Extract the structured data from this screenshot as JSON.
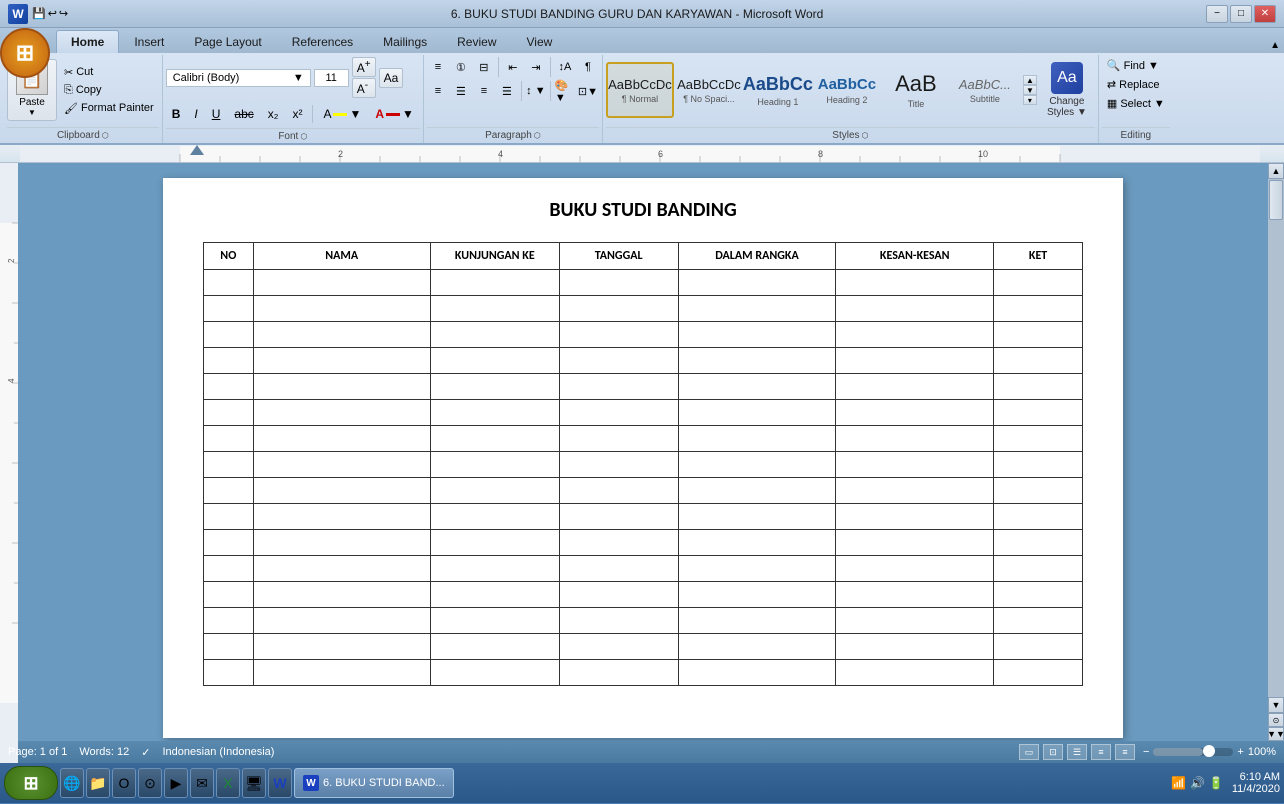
{
  "titlebar": {
    "title": "6. BUKU STUDI BANDING GURU DAN KARYAWAN - Microsoft Word",
    "minimize": "−",
    "maximize": "□",
    "close": "✕"
  },
  "tabs": [
    {
      "label": "Home",
      "active": true
    },
    {
      "label": "Insert",
      "active": false
    },
    {
      "label": "Page Layout",
      "active": false
    },
    {
      "label": "References",
      "active": false
    },
    {
      "label": "Mailings",
      "active": false
    },
    {
      "label": "Review",
      "active": false
    },
    {
      "label": "View",
      "active": false
    }
  ],
  "clipboard": {
    "label": "Clipboard",
    "paste_label": "Paste",
    "cut_label": "Cut",
    "copy_label": "Copy",
    "format_painter_label": "Format Painter"
  },
  "font": {
    "label": "Font",
    "name": "Calibri (Body)",
    "size": "11",
    "bold": "B",
    "italic": "I",
    "underline": "U",
    "strikethrough": "abc",
    "subscript": "x₂",
    "superscript": "x²",
    "clear": "A"
  },
  "paragraph": {
    "label": "Paragraph"
  },
  "styles": {
    "label": "Styles",
    "normal_label": "¶ Normal",
    "no_spacing_label": "¶ No Spaci...",
    "heading1_label": "Heading 1",
    "heading2_label": "Heading 2",
    "title_label": "Title",
    "subtitle_label": "Subtitle",
    "change_styles_label": "Change\nStyles"
  },
  "editing": {
    "label": "Editing",
    "find_label": "Find",
    "replace_label": "Replace",
    "select_label": "Select"
  },
  "document": {
    "title": "BUKU STUDI BANDING",
    "table_headers": [
      "NO",
      "NAMA",
      "KUNJUNGAN KE",
      "TANGGAL",
      "DALAM RANGKA",
      "KESAN-KESAN",
      "KET"
    ],
    "empty_rows": 16
  },
  "statusbar": {
    "page_info": "Page: 1 of 1",
    "words_label": "Words:",
    "word_count": "12",
    "language": "Indonesian (Indonesia)",
    "zoom": "100%"
  },
  "taskbar": {
    "start_label": "Start",
    "time": "6:10 AM",
    "date": "11/4/2020",
    "active_app": "Microsoft Word"
  }
}
